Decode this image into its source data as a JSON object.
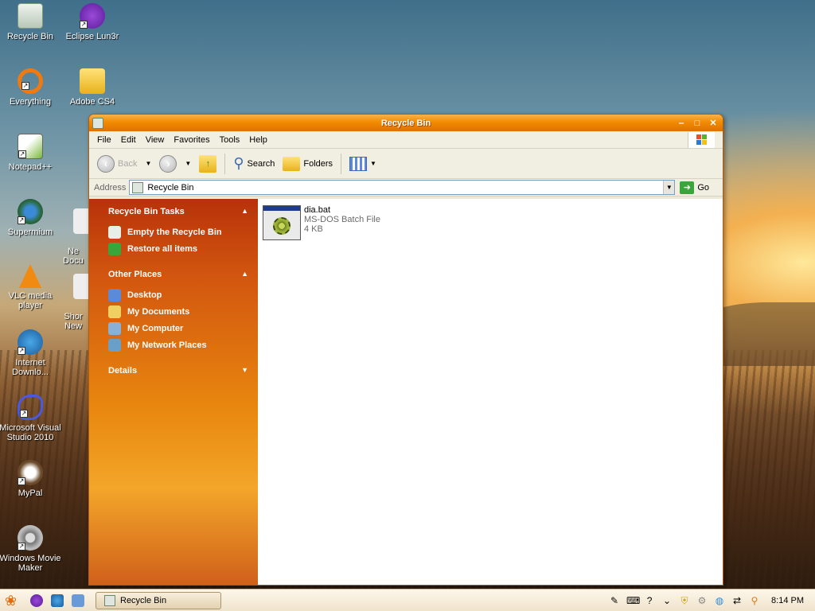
{
  "desktop": {
    "icons": [
      {
        "label": "Recycle Bin"
      },
      {
        "label": "Eclipse Lun3r"
      },
      {
        "label": "Everything"
      },
      {
        "label": "Adobe CS4"
      },
      {
        "label": "Notepad++"
      },
      {
        "label": "Supermium"
      },
      {
        "label": "VLC media player"
      },
      {
        "label": "Internet Downlo..."
      },
      {
        "label": "Microsoft Visual Studio 2010"
      },
      {
        "label": "MyPal"
      },
      {
        "label": "Windows Movie Maker"
      },
      {
        "label": "Ne\nDocu"
      },
      {
        "label": "Shor\nNew"
      }
    ]
  },
  "window": {
    "title": "Recycle Bin",
    "menu": [
      "File",
      "Edit",
      "View",
      "Favorites",
      "Tools",
      "Help"
    ],
    "toolbar": {
      "back": "Back",
      "search": "Search",
      "folders": "Folders"
    },
    "address": {
      "label": "Address",
      "value": "Recycle Bin",
      "go": "Go"
    },
    "taskpane": {
      "tasks_title": "Recycle Bin Tasks",
      "tasks": [
        "Empty the Recycle Bin",
        "Restore all items"
      ],
      "places_title": "Other Places",
      "places": [
        "Desktop",
        "My Documents",
        "My Computer",
        "My Network Places"
      ],
      "details_title": "Details"
    },
    "files": [
      {
        "name": "dia.bat",
        "type": "MS-DOS Batch File",
        "size": "4 KB"
      }
    ]
  },
  "taskbar": {
    "active_task": "Recycle Bin",
    "clock": "8:14 PM"
  },
  "colors": {
    "title_orange": "#f28b00",
    "taskpane_orange": "#d2560f",
    "taskbar_bg": "#f5ecdb"
  }
}
